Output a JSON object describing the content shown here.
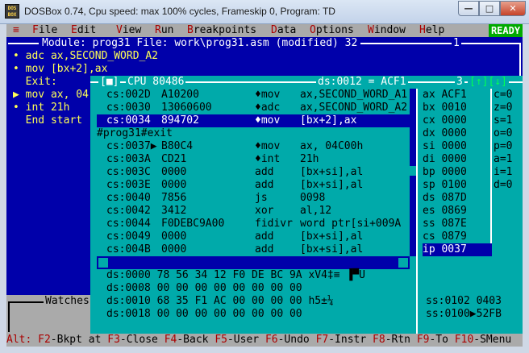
{
  "window": {
    "title": "DOSBox 0.74, Cpu speed: max 100% cycles, Frameskip  0, Program:       TD",
    "icon_text_top": "DOS",
    "icon_text_bottom": "BOX",
    "minimize": "—",
    "maximize": "□",
    "close": "✕"
  },
  "menu": {
    "system": "≡",
    "items": [
      "File",
      "Edit",
      "View",
      "Run",
      "Breakpoints",
      "Data",
      "Options",
      "Window",
      "Help"
    ],
    "hotkeys": [
      "F",
      "E",
      "V",
      "R",
      "B",
      "D",
      "O",
      "W",
      "H"
    ],
    "status": "READY"
  },
  "module_window": {
    "title": "Module: prog31 File: work\\prog31.asm (modified) 32",
    "number": "1",
    "lines": [
      "• adc ax,SECOND_WORD_A2",
      "• mov [bx+2],ax",
      "  Exit:",
      "▶ mov ax, 04",
      "• int 21h",
      "  End start"
    ]
  },
  "cpu_window": {
    "close_box": "[■]",
    "title": "CPU 80486",
    "ds_info": "ds:0012 = ACF1",
    "number": "3",
    "resize_box": "[↑][↓]",
    "code_rows": [
      {
        "addr": "cs:002D",
        "hex": "A10200",
        "mn": "♦mov",
        "op": "ax,SECOND_WORD_A1"
      },
      {
        "addr": "cs:0030",
        "hex": "13060600",
        "mn": "♦adc",
        "op": "ax,SECOND_WORD_A2"
      },
      {
        "addr": "cs:0034",
        "hex": "894702",
        "mn": "♦mov",
        "op": "[bx+2],ax"
      },
      {
        "label": "#prog31#exit"
      },
      {
        "addr": "cs:0037▶",
        "hex": "B80C4",
        "mn": "♦mov",
        "op": "ax, 04C00h"
      },
      {
        "addr": "cs:003A",
        "hex": "CD21",
        "mn": "♦int",
        "op": "21h"
      },
      {
        "addr": "cs:003C",
        "hex": "0000",
        "mn": "add",
        "op": "[bx+si],al"
      },
      {
        "addr": "cs:003E",
        "hex": "0000",
        "mn": "add",
        "op": "[bx+si],al"
      },
      {
        "addr": "cs:0040",
        "hex": "7856",
        "mn": "js",
        "op": "0098"
      },
      {
        "addr": "cs:0042",
        "hex": "3412",
        "mn": "xor",
        "op": "al,12"
      },
      {
        "addr": "cs:0044",
        "hex": "F0DEBC9A00",
        "mn": "fidivr",
        "op": "word ptr[si+009A"
      },
      {
        "addr": "cs:0049",
        "hex": "0000",
        "mn": "add",
        "op": "[bx+si],al"
      },
      {
        "addr": "cs:004B",
        "hex": "0000",
        "mn": "add",
        "op": "[bx+si],al"
      }
    ],
    "selected_code_row": 2,
    "registers": [
      {
        "name": "ax",
        "value": "ACF1"
      },
      {
        "name": "bx",
        "value": "0010"
      },
      {
        "name": "cx",
        "value": "0000"
      },
      {
        "name": "dx",
        "value": "0000"
      },
      {
        "name": "si",
        "value": "0000"
      },
      {
        "name": "di",
        "value": "0000"
      },
      {
        "name": "bp",
        "value": "0000"
      },
      {
        "name": "sp",
        "value": "0100"
      },
      {
        "name": "ds",
        "value": "087D"
      },
      {
        "name": "es",
        "value": "0869"
      },
      {
        "name": "ss",
        "value": "087E"
      },
      {
        "name": "cs",
        "value": "0879"
      },
      {
        "name": "ip",
        "value": "0037"
      }
    ],
    "selected_register": 12,
    "flags": [
      "c=0",
      "z=0",
      "s=1",
      "o=0",
      "p=0",
      "a=1",
      "i=1",
      "d=0"
    ],
    "dump_rows": [
      "ds:0000 78 56 34 12 F0 DE BC 9A xV4‡≡ ▐▀U",
      "ds:0008 00 00 00 00 00 00 00 00",
      "ds:0010 68 35 F1 AC 00 00 00 00 h5±¼",
      "ds:0018 00 00 00 00 00 00 00 00"
    ],
    "stack_rows": [
      "ss:0102 0403",
      "ss:0100▶52FB"
    ]
  },
  "watches": {
    "title": "Watches"
  },
  "statusbar": {
    "items": [
      {
        "key": "Alt:",
        "label": ""
      },
      {
        "key": "F2",
        "label": "-Bkpt at"
      },
      {
        "key": "F3",
        "label": "-Close"
      },
      {
        "key": "F4",
        "label": "-Back"
      },
      {
        "key": "F5",
        "label": "-User"
      },
      {
        "key": "F6",
        "label": "-Undo"
      },
      {
        "key": "F7",
        "label": "-Instr"
      },
      {
        "key": "F8",
        "label": "-Rtn"
      },
      {
        "key": "F9",
        "label": "-To"
      },
      {
        "key": "F10",
        "label": "-SMenu"
      }
    ]
  }
}
